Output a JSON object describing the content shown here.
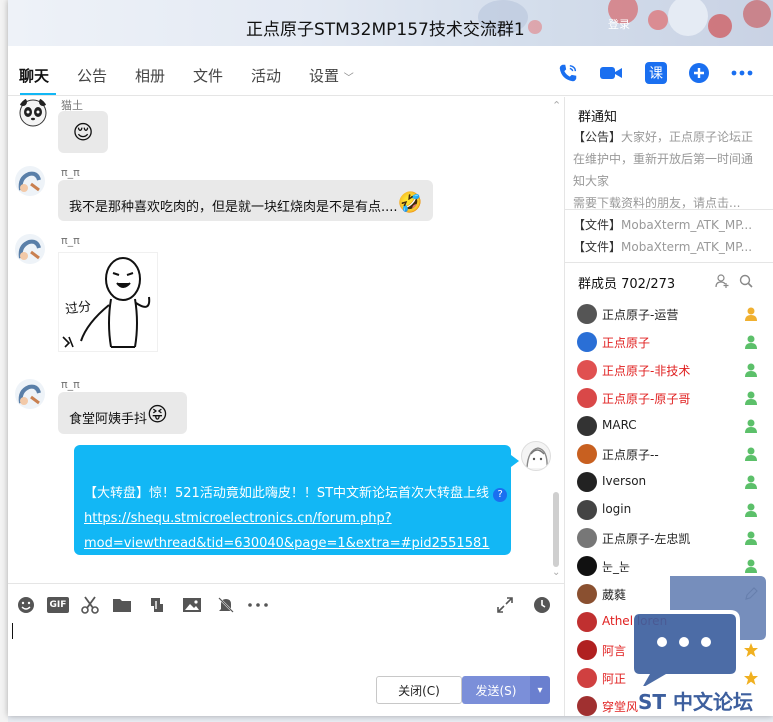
{
  "window": {
    "title": "正点原子STM32MP157技术交流群1",
    "controls": [
      "·",
      "登录"
    ]
  },
  "tabs": [
    {
      "label": "聊天",
      "active": true
    },
    {
      "label": "公告"
    },
    {
      "label": "相册"
    },
    {
      "label": "文件"
    },
    {
      "label": "活动"
    },
    {
      "label": "设置"
    }
  ],
  "tab_icons": [
    "phone-icon",
    "video-icon",
    "lesson-icon",
    "add-app-icon",
    "more-icon"
  ],
  "lesson_icon_text": "课",
  "messages": [
    {
      "sender": "猫土",
      "type": "emoji",
      "content": "😌"
    },
    {
      "sender": "π_π",
      "type": "text",
      "content": "我不是那种喜欢吃肉的，但是就一块红烧肉是不是有点....",
      "emoji": "🤣"
    },
    {
      "sender": "π_π",
      "type": "image",
      "sticker_text": "过分"
    },
    {
      "sender": "π_π",
      "type": "text",
      "content": "食堂阿姨手抖",
      "emoji": "😝"
    },
    {
      "sender": "self",
      "type": "link",
      "prefix": "【大转盘】惊！521活动竟如此嗨皮！！ST中文新论坛首次大转盘上线",
      "link_line1": "https://shequ.stmicroelectronics.cn/forum.php?",
      "link_line2": "mod=viewthread&tid=630040&page=1&extra=#pid2551581"
    }
  ],
  "toolbar": {
    "icons": [
      "smiley-icon",
      "gif-icon",
      "scissors-icon",
      "folder-icon",
      "shake-icon",
      "image-icon",
      "mute-icon",
      "more-icon",
      "expand-icon",
      "clock-icon"
    ],
    "gif_label": "GIF"
  },
  "buttons": {
    "close": "关闭(C)",
    "send": "发送(S)"
  },
  "notice": {
    "title": "群通知",
    "prefix": "【公告】",
    "body": "大家好，正点原子论坛正在维护中，重新开放后第一时间通知大家",
    "body2": "需要下载资料的朋友，请点击..."
  },
  "files": [
    {
      "prefix": "【文件】",
      "name": "MobaXterm_ATK_MP..."
    },
    {
      "prefix": "【文件】",
      "name": "MobaXterm_ATK_MP..."
    }
  ],
  "members": {
    "title": "群成员 702/273",
    "list": [
      {
        "name": "正点原子-运营",
        "color": "#222222",
        "role": "owner"
      },
      {
        "name": "正点原子",
        "color": "#e02020",
        "role": "admin"
      },
      {
        "name": "正点原子-非技术",
        "color": "#e02020",
        "role": "admin"
      },
      {
        "name": "正点原子-原子哥",
        "color": "#e02020",
        "role": "admin"
      },
      {
        "name": "MARC",
        "color": "#222222",
        "role": "admin"
      },
      {
        "name": "正点原子--",
        "color": "#222222",
        "role": "admin"
      },
      {
        "name": "Iverson",
        "color": "#222222",
        "role": "admin"
      },
      {
        "name": "login",
        "color": "#222222",
        "role": "admin"
      },
      {
        "name": "正点原子-左忠凯",
        "color": "#222222",
        "role": "admin"
      },
      {
        "name": "눈_눈",
        "color": "#222222",
        "role": "admin"
      },
      {
        "name": "葳蕤",
        "color": "#222222",
        "role": "edit"
      },
      {
        "name": "Athel loren",
        "color": "#e02020",
        "role": "none"
      },
      {
        "name": "阿言",
        "color": "#e02020",
        "role": "star"
      },
      {
        "name": "阿正",
        "color": "#e02020",
        "role": "star"
      },
      {
        "name": "穿堂风",
        "color": "#e02020",
        "role": "none"
      }
    ]
  },
  "watermark": {
    "text": "ST 中文论坛"
  },
  "colors": {
    "accent": "#12b7f5",
    "send": "#7b8fd9",
    "admin_red": "#e02020"
  }
}
